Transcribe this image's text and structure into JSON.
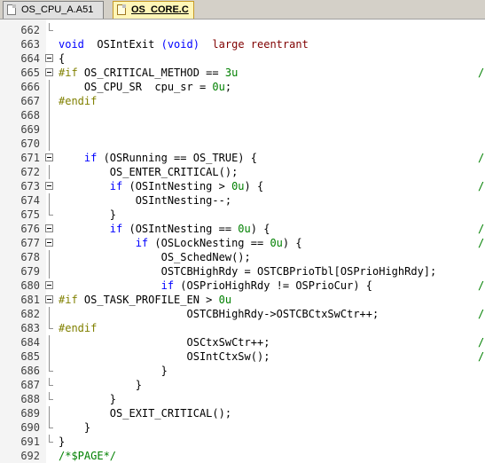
{
  "tabs": [
    {
      "label": "OS_CPU_A.A51",
      "active": false
    },
    {
      "label": "OS_CORE.C",
      "active": true
    }
  ],
  "colors": {
    "keyword": "#0000ff",
    "preprocessor": "#808000",
    "number": "#008000",
    "comment": "#008000",
    "active_tab": "#fff6b8"
  },
  "editor": {
    "lines": [
      {
        "n": "662",
        "fold": "end",
        "t": [],
        "trail": ""
      },
      {
        "n": "663",
        "fold": "",
        "t": [
          [
            "kw",
            "void"
          ],
          [
            "",
            "  OSIntExit "
          ],
          [
            "kw",
            "(void)"
          ],
          [
            "",
            "  "
          ],
          [
            "str",
            "large reentrant"
          ]
        ],
        "trail": ""
      },
      {
        "n": "664",
        "fold": "box",
        "t": [
          [
            "",
            "{"
          ]
        ],
        "trail": ""
      },
      {
        "n": "665",
        "fold": "box",
        "t": [
          [
            "pp",
            "#if"
          ],
          [
            "",
            " OS_CRITICAL_METHOD == "
          ],
          [
            "num",
            "3u"
          ]
        ],
        "trail": "/"
      },
      {
        "n": "666",
        "fold": "line",
        "t": [
          [
            "",
            "    OS_CPU_SR  cpu_sr = "
          ],
          [
            "num",
            "0u"
          ],
          [
            "",
            ";"
          ]
        ],
        "trail": ""
      },
      {
        "n": "667",
        "fold": "line",
        "t": [
          [
            "pp",
            "#endif"
          ]
        ],
        "trail": ""
      },
      {
        "n": "668",
        "fold": "line",
        "t": [],
        "trail": ""
      },
      {
        "n": "669",
        "fold": "line",
        "t": [],
        "trail": ""
      },
      {
        "n": "670",
        "fold": "line",
        "t": [],
        "trail": ""
      },
      {
        "n": "671",
        "fold": "box",
        "t": [
          [
            "",
            "    "
          ],
          [
            "kw",
            "if"
          ],
          [
            "",
            " (OSRunning == OS_TRUE) {"
          ]
        ],
        "trail": "/"
      },
      {
        "n": "672",
        "fold": "line",
        "t": [
          [
            "",
            "        OS_ENTER_CRITICAL();"
          ]
        ],
        "trail": ""
      },
      {
        "n": "673",
        "fold": "box",
        "t": [
          [
            "",
            "        "
          ],
          [
            "kw",
            "if"
          ],
          [
            "",
            " (OSIntNesting > "
          ],
          [
            "num",
            "0u"
          ],
          [
            "",
            ") {"
          ]
        ],
        "trail": "/"
      },
      {
        "n": "674",
        "fold": "line",
        "t": [
          [
            "",
            "            OSIntNesting--;"
          ]
        ],
        "trail": ""
      },
      {
        "n": "675",
        "fold": "end",
        "t": [
          [
            "",
            "        }"
          ]
        ],
        "trail": ""
      },
      {
        "n": "676",
        "fold": "box",
        "t": [
          [
            "",
            "        "
          ],
          [
            "kw",
            "if"
          ],
          [
            "",
            " (OSIntNesting == "
          ],
          [
            "num",
            "0u"
          ],
          [
            "",
            ") {"
          ]
        ],
        "trail": "/"
      },
      {
        "n": "677",
        "fold": "box",
        "t": [
          [
            "",
            "            "
          ],
          [
            "kw",
            "if"
          ],
          [
            "",
            " (OSLockNesting == "
          ],
          [
            "num",
            "0u"
          ],
          [
            "",
            ") {"
          ]
        ],
        "trail": "/"
      },
      {
        "n": "678",
        "fold": "line",
        "t": [
          [
            "",
            "                OS_SchedNew();"
          ]
        ],
        "trail": ""
      },
      {
        "n": "679",
        "fold": "line",
        "t": [
          [
            "",
            "                OSTCBHighRdy = OSTCBPrioTbl[OSPrioHighRdy];"
          ]
        ],
        "trail": ""
      },
      {
        "n": "680",
        "fold": "box",
        "t": [
          [
            "",
            "                "
          ],
          [
            "kw",
            "if"
          ],
          [
            "",
            " (OSPrioHighRdy != OSPrioCur) {"
          ]
        ],
        "trail": "/"
      },
      {
        "n": "681",
        "fold": "box",
        "t": [
          [
            "pp",
            "#if"
          ],
          [
            "",
            " OS_TASK_PROFILE_EN > "
          ],
          [
            "num",
            "0u"
          ]
        ],
        "trail": ""
      },
      {
        "n": "682",
        "fold": "line",
        "t": [
          [
            "",
            "                    OSTCBHighRdy->OSTCBCtxSwCtr++;"
          ]
        ],
        "trail": "/"
      },
      {
        "n": "683",
        "fold": "end",
        "t": [
          [
            "pp",
            "#endif"
          ]
        ],
        "trail": ""
      },
      {
        "n": "684",
        "fold": "line",
        "t": [
          [
            "",
            "                    OSCtxSwCtr++;"
          ]
        ],
        "trail": "/"
      },
      {
        "n": "685",
        "fold": "line",
        "t": [
          [
            "",
            "                    OSIntCtxSw();"
          ]
        ],
        "trail": "/"
      },
      {
        "n": "686",
        "fold": "end",
        "t": [
          [
            "",
            "                }"
          ]
        ],
        "trail": ""
      },
      {
        "n": "687",
        "fold": "end",
        "t": [
          [
            "",
            "            }"
          ]
        ],
        "trail": ""
      },
      {
        "n": "688",
        "fold": "end",
        "t": [
          [
            "",
            "        }"
          ]
        ],
        "trail": ""
      },
      {
        "n": "689",
        "fold": "line",
        "t": [
          [
            "",
            "        OS_EXIT_CRITICAL();"
          ]
        ],
        "trail": ""
      },
      {
        "n": "690",
        "fold": "end",
        "t": [
          [
            "",
            "    }"
          ]
        ],
        "trail": ""
      },
      {
        "n": "691",
        "fold": "end",
        "t": [
          [
            "",
            "}"
          ]
        ],
        "trail": ""
      },
      {
        "n": "692",
        "fold": "",
        "t": [
          [
            "cm",
            "/*$PAGE*/"
          ]
        ],
        "trail": ""
      }
    ]
  }
}
